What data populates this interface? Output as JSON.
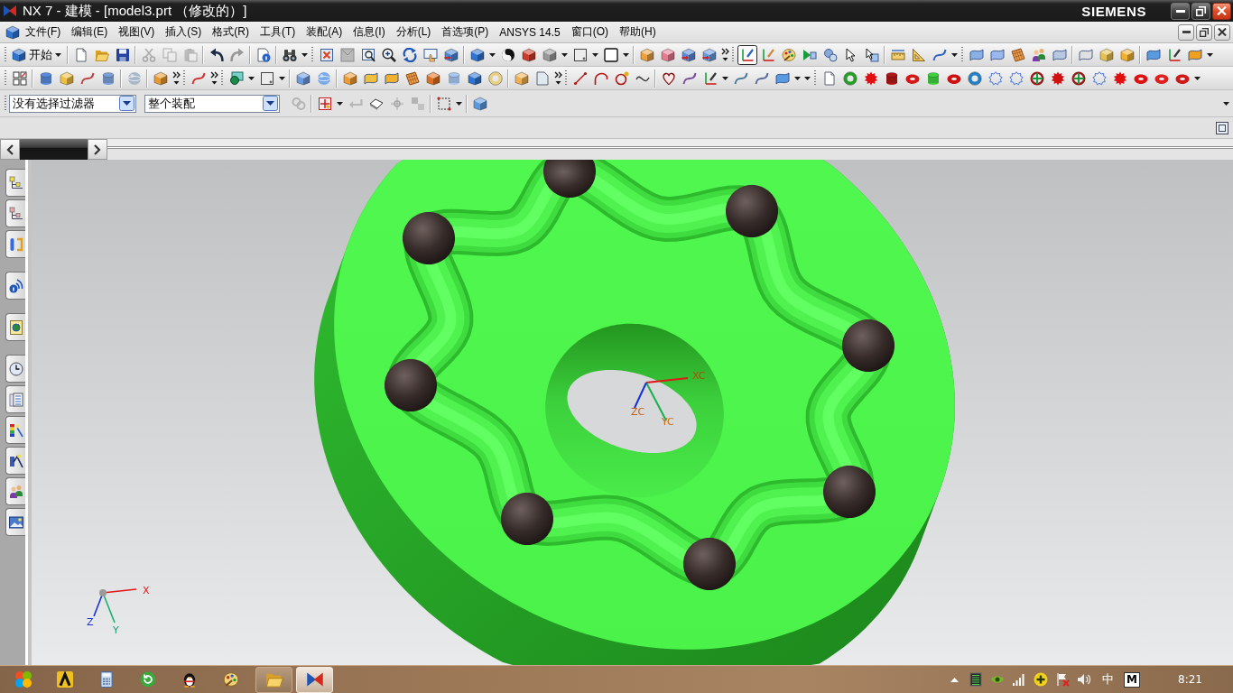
{
  "window": {
    "title": "NX 7 - 建模 - [model3.prt （修改的）]",
    "brand": "SIEMENS"
  },
  "menu_bar": {
    "items": [
      "文件(F)",
      "编辑(E)",
      "视图(V)",
      "插入(S)",
      "格式(R)",
      "工具(T)",
      "装配(A)",
      "信息(I)",
      "分析(L)",
      "首选项(P)",
      "ANSYS 14.5",
      "窗口(O)",
      "帮助(H)"
    ]
  },
  "standard_toolbar": {
    "start_label": "开始",
    "clipboard_buttons": [
      {
        "kind": "cut",
        "disabled": true
      },
      {
        "kind": "copy",
        "disabled": true
      },
      {
        "kind": "paste",
        "disabled": true
      }
    ],
    "history_buttons": [
      {
        "kind": "undo",
        "disabled": false
      },
      {
        "kind": "redo",
        "disabled": true
      }
    ]
  },
  "snap_toolbar": {
    "buttons": [
      {
        "kind": "csys",
        "selected": true
      },
      {
        "kind": "axes",
        "selected": false
      },
      {
        "kind": "palette",
        "selected": false
      },
      {
        "kind": "play",
        "selected": false
      },
      {
        "kind": "circles",
        "selected": false
      },
      {
        "kind": "cursor",
        "selected": false
      },
      {
        "kind": "cursor_box",
        "selected": false
      }
    ]
  },
  "selection_bar": {
    "type_filter": {
      "value": "没有选择过滤器"
    },
    "scope": {
      "value": "整个装配"
    },
    "assembly_button": {
      "disabled": true
    },
    "tools": [
      {
        "kind": "snap",
        "disabled": false
      },
      {
        "kind": "back",
        "disabled": true
      },
      {
        "kind": "eraser",
        "disabled": false
      },
      {
        "kind": "point",
        "disabled": true
      },
      {
        "kind": "chain",
        "disabled": true
      }
    ]
  },
  "viewport": {
    "wcs_labels": {
      "x": "XC",
      "y": "YC",
      "z": "ZC"
    },
    "absolute_labels": {
      "x": "X",
      "y": "Y",
      "z": "Z"
    }
  },
  "taskbar": {
    "windows": [
      {
        "kind": "folder",
        "selected": false
      },
      {
        "kind": "app",
        "selected": true
      }
    ],
    "ime": "中",
    "ime_mode": "M",
    "clock": "8:21"
  }
}
